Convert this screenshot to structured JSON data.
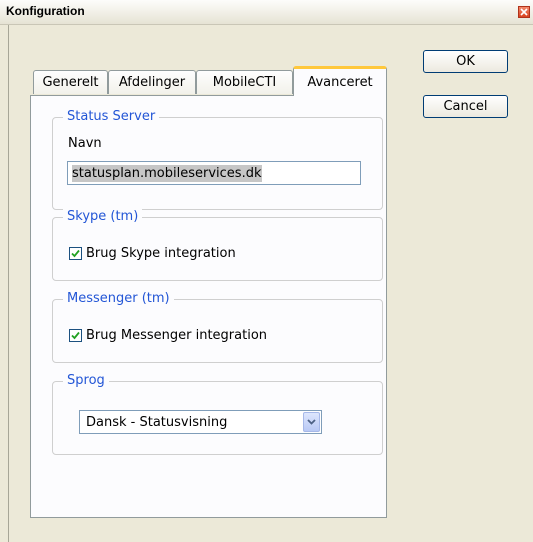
{
  "window": {
    "title": "Konfiguration"
  },
  "tabs": [
    {
      "label": "Generelt",
      "active": false
    },
    {
      "label": "Afdelinger",
      "active": false
    },
    {
      "label": "MobileCTI",
      "active": false
    },
    {
      "label": "Avanceret",
      "active": true
    }
  ],
  "buttons": {
    "ok": "OK",
    "cancel": "Cancel"
  },
  "status_server": {
    "title": "Status Server",
    "name_label": "Navn",
    "name_value": "statusplan.mobileservices.dk"
  },
  "skype": {
    "title": "Skype (tm)",
    "checkbox_label": "Brug Skype integration",
    "checked": true
  },
  "messenger": {
    "title": "Messenger (tm)",
    "checkbox_label": "Brug Messenger integration",
    "checked": true
  },
  "language": {
    "title": "Sprog",
    "selected": "Dansk - Statusvisning"
  },
  "colors": {
    "group_title": "#2356d6",
    "active_tab_accent": "#ffc83c",
    "check_mark": "#21a121"
  },
  "icons": {
    "close": "close-icon",
    "check": "check-icon",
    "dropdown": "chevron-down-icon"
  }
}
